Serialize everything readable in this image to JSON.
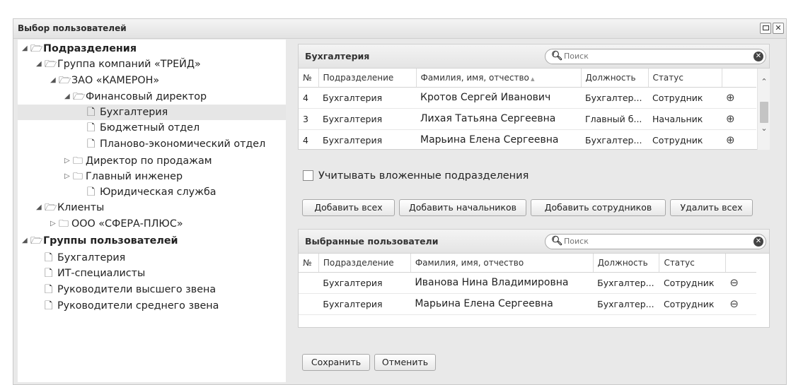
{
  "window": {
    "title": "Выбор пользователей",
    "maximize_icon": "maximize-icon",
    "close_glyph": "✕"
  },
  "tree": {
    "nodes": [
      {
        "label": "Подразделения",
        "arrow": "◢",
        "icon": "🗁",
        "bold": true
      },
      {
        "label": "Группа компаний «ТРЕЙД»",
        "arrow": "◢",
        "icon": "🗁"
      },
      {
        "label": "ЗАО «КАМЕРОН»",
        "arrow": "◢",
        "icon": "🗁"
      },
      {
        "label": "Финансовый директор",
        "arrow": "◢",
        "icon": "🗁"
      },
      {
        "label": "Бухгалтерия",
        "arrow": "",
        "icon": "🗋",
        "selected": true
      },
      {
        "label": "Бюджетный отдел",
        "arrow": "",
        "icon": "🗋"
      },
      {
        "label": "Планово-экономический отдел",
        "arrow": "",
        "icon": "🗋"
      },
      {
        "label": "Директор по продажам",
        "arrow": "▷",
        "icon": "🗀"
      },
      {
        "label": "Главный инженер",
        "arrow": "▷",
        "icon": "🗀"
      },
      {
        "label": "Юридическая служба",
        "arrow": "",
        "icon": "🗋"
      },
      {
        "label": "Клиенты",
        "arrow": "◢",
        "icon": "🗁"
      },
      {
        "label": "ООО «СФЕРА-ПЛЮС»",
        "arrow": "▷",
        "icon": "🗀"
      },
      {
        "label": "Группы пользователей",
        "arrow": "◢",
        "icon": "🗁",
        "bold": true
      },
      {
        "label": "Бухгалтерия",
        "arrow": "",
        "icon": "🗋"
      },
      {
        "label": "ИТ-специалисты",
        "arrow": "",
        "icon": "🗋"
      },
      {
        "label": "Руководители высшего звена",
        "arrow": "",
        "icon": "🗋"
      },
      {
        "label": "Руководители среднего звена",
        "arrow": "",
        "icon": "🗋"
      }
    ]
  },
  "top_panel": {
    "title": "Бухгалтерия",
    "search_placeholder": "Поиск",
    "columns": [
      "№",
      "Подразделение",
      "Фамилия, имя, отчество",
      "Должность",
      "Статус"
    ],
    "rows": [
      {
        "num": "4",
        "dept": "Бухгалтерия",
        "name": "Кротов Сергей Иванович",
        "position": "Бухгалтер...",
        "status": "Сотрудник",
        "action": "⊕"
      },
      {
        "num": "3",
        "dept": "Бухгалтерия",
        "name": "Лихая Татьяна Сергеевна",
        "position": "Главный б...",
        "status": "Начальник",
        "action": "⊕"
      },
      {
        "num": "4",
        "dept": "Бухгалтерия",
        "name": "Марьина Елена Сергеевна",
        "position": "Бухгалтер...",
        "status": "Сотрудник",
        "action": "⊕"
      }
    ],
    "include_nested_label": "Учитывать вложенные подразделения",
    "buttons": {
      "add_all": "Добавить всех",
      "add_heads": "Добавить начальников",
      "add_employees": "Добавить сотрудников",
      "remove_all": "Удалить всех"
    }
  },
  "bottom_panel": {
    "title": "Выбранные пользователи",
    "search_placeholder": "Поиск",
    "columns": [
      "№",
      "Подразделение",
      "Фамилия, имя, отчество",
      "Должность",
      "Статус"
    ],
    "rows": [
      {
        "num": "",
        "dept": "Бухгалтерия",
        "name": "Иванова Нина Владимировна",
        "position": "Бухгалтер...",
        "status": "Сотрудник",
        "action": "⊖"
      },
      {
        "num": "",
        "dept": "Бухгалтерия",
        "name": "Марьина Елена Сергеевна",
        "position": "Бухгалтер...",
        "status": "Сотрудник",
        "action": "⊖"
      }
    ]
  },
  "footer": {
    "save": "Сохранить",
    "cancel": "Отменить"
  }
}
